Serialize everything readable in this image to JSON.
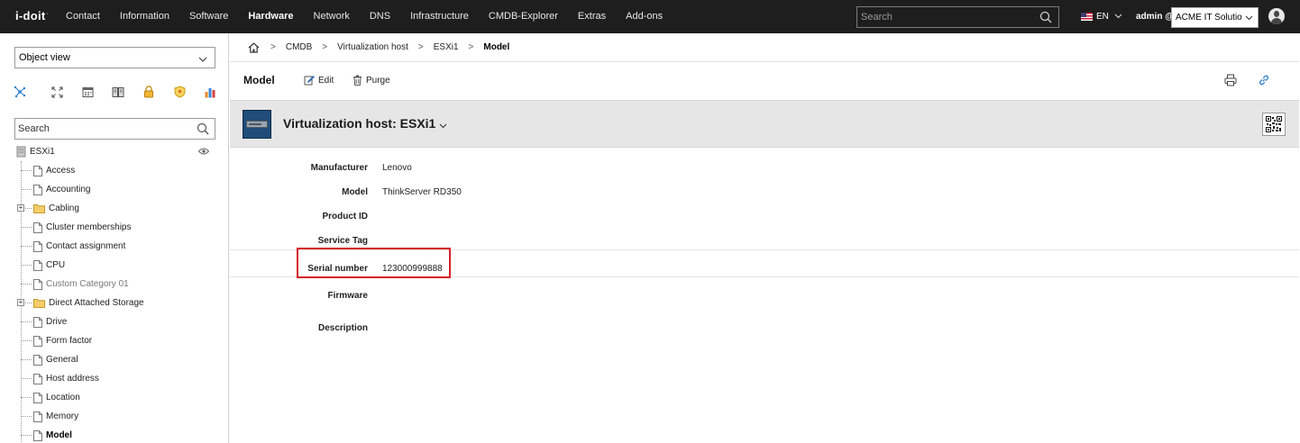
{
  "topbar": {
    "logo": "i-doit",
    "logo_sup": "·",
    "nav": [
      "Contact",
      "Information",
      "Software",
      "Hardware",
      "Network",
      "DNS",
      "Infrastructure",
      "CMDB-Explorer",
      "Extras",
      "Add-ons"
    ],
    "active_nav": "Hardware",
    "search_placeholder": "Search",
    "language": "EN",
    "user": "admin @",
    "tenant": "ACME IT Solutions"
  },
  "sidebar": {
    "view_select": "Object view",
    "icons": [
      "network-icon",
      "expand-icon",
      "calendar-icon",
      "book-icon",
      "lock-icon",
      "shield-icon",
      "chart-icon"
    ],
    "search_placeholder": "Search",
    "tree_root": "ESXi1",
    "tree_items": [
      {
        "label": "Access",
        "type": "page"
      },
      {
        "label": "Accounting",
        "type": "page"
      },
      {
        "label": "Cabling",
        "type": "folder"
      },
      {
        "label": "Cluster memberships",
        "type": "page"
      },
      {
        "label": "Contact assignment",
        "type": "page"
      },
      {
        "label": "CPU",
        "type": "page"
      },
      {
        "label": "Custom Category 01",
        "type": "page",
        "dim": true
      },
      {
        "label": "Direct Attached Storage",
        "type": "folder"
      },
      {
        "label": "Drive",
        "type": "page"
      },
      {
        "label": "Form factor",
        "type": "page"
      },
      {
        "label": "General",
        "type": "page"
      },
      {
        "label": "Host address",
        "type": "page"
      },
      {
        "label": "Location",
        "type": "page"
      },
      {
        "label": "Memory",
        "type": "page"
      },
      {
        "label": "Model",
        "type": "page",
        "current": true
      }
    ]
  },
  "breadcrumb": [
    "CMDB",
    "Virtualization host",
    "ESXi1",
    "Model"
  ],
  "toolbar": {
    "title": "Model",
    "edit_label": "Edit",
    "purge_label": "Purge"
  },
  "object": {
    "title": "Virtualization host: ESXi1"
  },
  "form": {
    "fields": [
      {
        "label": "Manufacturer",
        "value": "Lenovo"
      },
      {
        "label": "Model",
        "value": "ThinkServer RD350"
      },
      {
        "label": "Product ID",
        "value": ""
      },
      {
        "label": "Service Tag",
        "value": ""
      },
      {
        "label": "Serial number",
        "value": "123000999888"
      },
      {
        "label": "Firmware",
        "value": ""
      },
      {
        "label": "Description",
        "value": ""
      }
    ]
  },
  "colors": {
    "topbar_bg": "#1e1e1e",
    "header_bg": "#e6e6e6",
    "highlight": "#d6202a",
    "icon_blue": "#2f7fcf"
  }
}
